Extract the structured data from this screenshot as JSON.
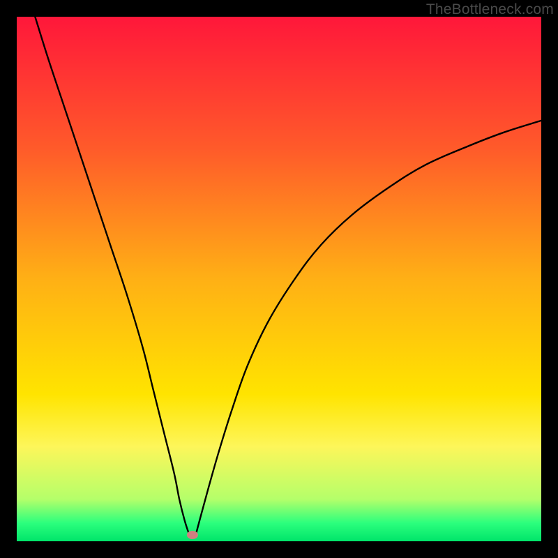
{
  "watermark": "TheBottleneck.com",
  "chart_data": {
    "type": "line",
    "title": "",
    "xlabel": "",
    "ylabel": "",
    "xlim": [
      0,
      100
    ],
    "ylim": [
      0,
      100
    ],
    "grid": false,
    "legend": false,
    "background_gradient": {
      "stops": [
        {
          "offset": 0.0,
          "color": "#ff173a"
        },
        {
          "offset": 0.25,
          "color": "#ff5a2a"
        },
        {
          "offset": 0.5,
          "color": "#ffb015"
        },
        {
          "offset": 0.72,
          "color": "#ffe400"
        },
        {
          "offset": 0.82,
          "color": "#fdf65a"
        },
        {
          "offset": 0.92,
          "color": "#b4ff6a"
        },
        {
          "offset": 0.965,
          "color": "#2cff7d"
        },
        {
          "offset": 1.0,
          "color": "#00e56a"
        }
      ]
    },
    "series": [
      {
        "name": "left-branch",
        "x": [
          3.5,
          6,
          9,
          12,
          15,
          18,
          21,
          24,
          26,
          28,
          30,
          31,
          32,
          32.8
        ],
        "y": [
          100,
          92,
          83,
          74,
          65,
          56,
          47,
          37,
          29,
          21,
          13,
          8,
          4,
          1.5
        ]
      },
      {
        "name": "right-branch",
        "x": [
          34.2,
          35,
          36.5,
          38.5,
          41,
          44,
          48,
          53,
          58,
          64,
          71,
          78,
          86,
          93,
          100
        ],
        "y": [
          1.5,
          4.5,
          10,
          17,
          25,
          33.5,
          42,
          50,
          56.5,
          62.3,
          67.5,
          71.8,
          75.3,
          78,
          80.2
        ]
      }
    ],
    "marker": {
      "name": "min-point",
      "x": 33.5,
      "y": 1.2,
      "color": "#d08080",
      "rx": 8,
      "ry": 6
    }
  }
}
